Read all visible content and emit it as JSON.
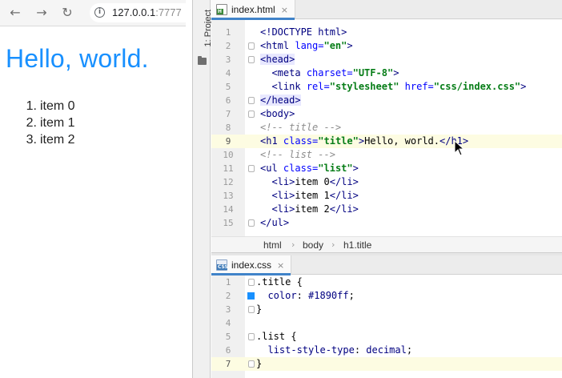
{
  "browser": {
    "url_host": "127.0.0.1",
    "url_port": ":7777",
    "icons": {
      "back": "arrow-left-icon",
      "forward": "arrow-right-icon",
      "reload": "reload-icon",
      "info": "info-icon"
    },
    "page": {
      "heading": "Hello, world.",
      "heading_color": "#1890ff",
      "list": [
        {
          "num": "1.",
          "text": "item 0"
        },
        {
          "num": "2.",
          "text": "item 1"
        },
        {
          "num": "3.",
          "text": "item 2"
        }
      ]
    }
  },
  "ide": {
    "project_tool_label": "1: Project",
    "html_tab": {
      "label": "index.html",
      "badge": "H",
      "close": "×"
    },
    "css_tab": {
      "label": "index.css",
      "badge": "CSS",
      "close": "×"
    },
    "html_lines": [
      {
        "n": "1"
      },
      {
        "n": "2"
      },
      {
        "n": "3"
      },
      {
        "n": "4"
      },
      {
        "n": "5"
      },
      {
        "n": "6"
      },
      {
        "n": "7"
      },
      {
        "n": "8"
      },
      {
        "n": "9"
      },
      {
        "n": "10"
      },
      {
        "n": "11"
      },
      {
        "n": "12"
      },
      {
        "n": "13"
      },
      {
        "n": "14"
      },
      {
        "n": "15"
      }
    ],
    "html_current_line": "9",
    "breadcrumb": [
      "html",
      "body",
      "h1.title"
    ],
    "css_lines": [
      {
        "n": "1"
      },
      {
        "n": "2"
      },
      {
        "n": "3"
      },
      {
        "n": "4"
      },
      {
        "n": "5"
      },
      {
        "n": "6"
      },
      {
        "n": "7"
      }
    ],
    "css_current_line": "7",
    "accent_color": "#4083c9",
    "color_swatch": "#1890ff"
  }
}
